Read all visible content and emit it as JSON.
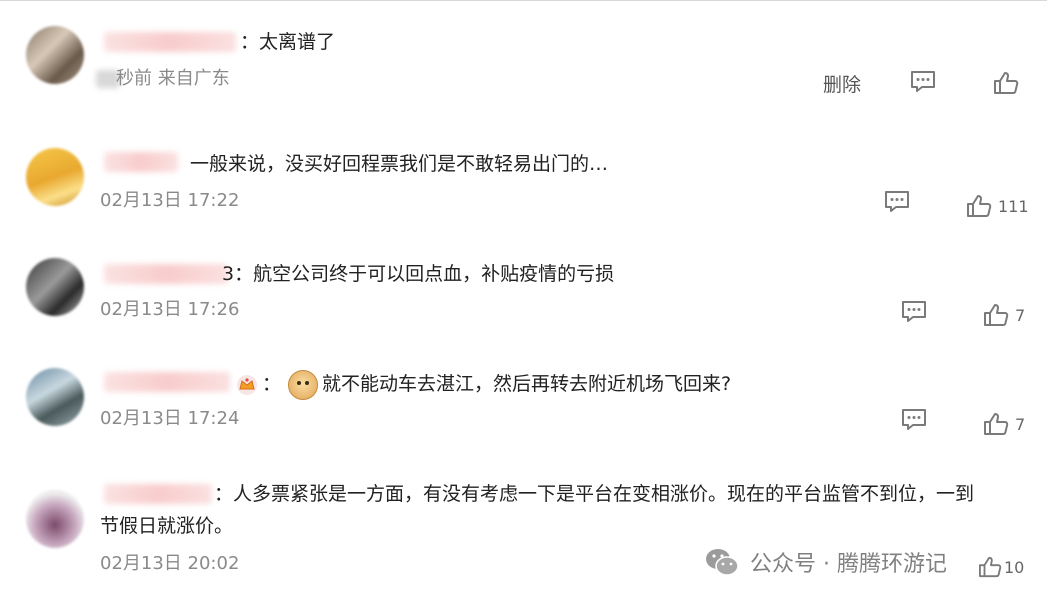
{
  "comments": [
    {
      "text": "：太离谱了",
      "time_prefix": "秒前",
      "location": "来自广东",
      "delete_label": "删除",
      "likes": ""
    },
    {
      "text": "一般来说，没买好回程票我们是不敢轻易出门的…",
      "time": "02月13日 17:22",
      "likes": "111"
    },
    {
      "text": "3：航空公司终于可以回点血，补贴疫情的亏损",
      "time": "02月13日 17:26",
      "likes": "7"
    },
    {
      "colon": "：",
      "text": "就不能动车去湛江，然后再转去附近机场飞回来?",
      "time": "02月13日 17:24",
      "likes": "7"
    },
    {
      "line1": "：人多票紧张是一方面，有没有考虑一下是平台在变相涨价。现在的平台监管不到位，一到",
      "line2": "节假日就涨价。",
      "time": "02月13日 20:02",
      "likes": "10"
    }
  ],
  "watermark": {
    "text": "公众号 · 腾腾环游记"
  },
  "icons": {
    "comment": "comment-bubble-icon",
    "like": "thumbs-up-icon",
    "vip": "crown-badge-icon",
    "emoji": "doge-emoji-icon",
    "watermark": "wechat-icon"
  }
}
